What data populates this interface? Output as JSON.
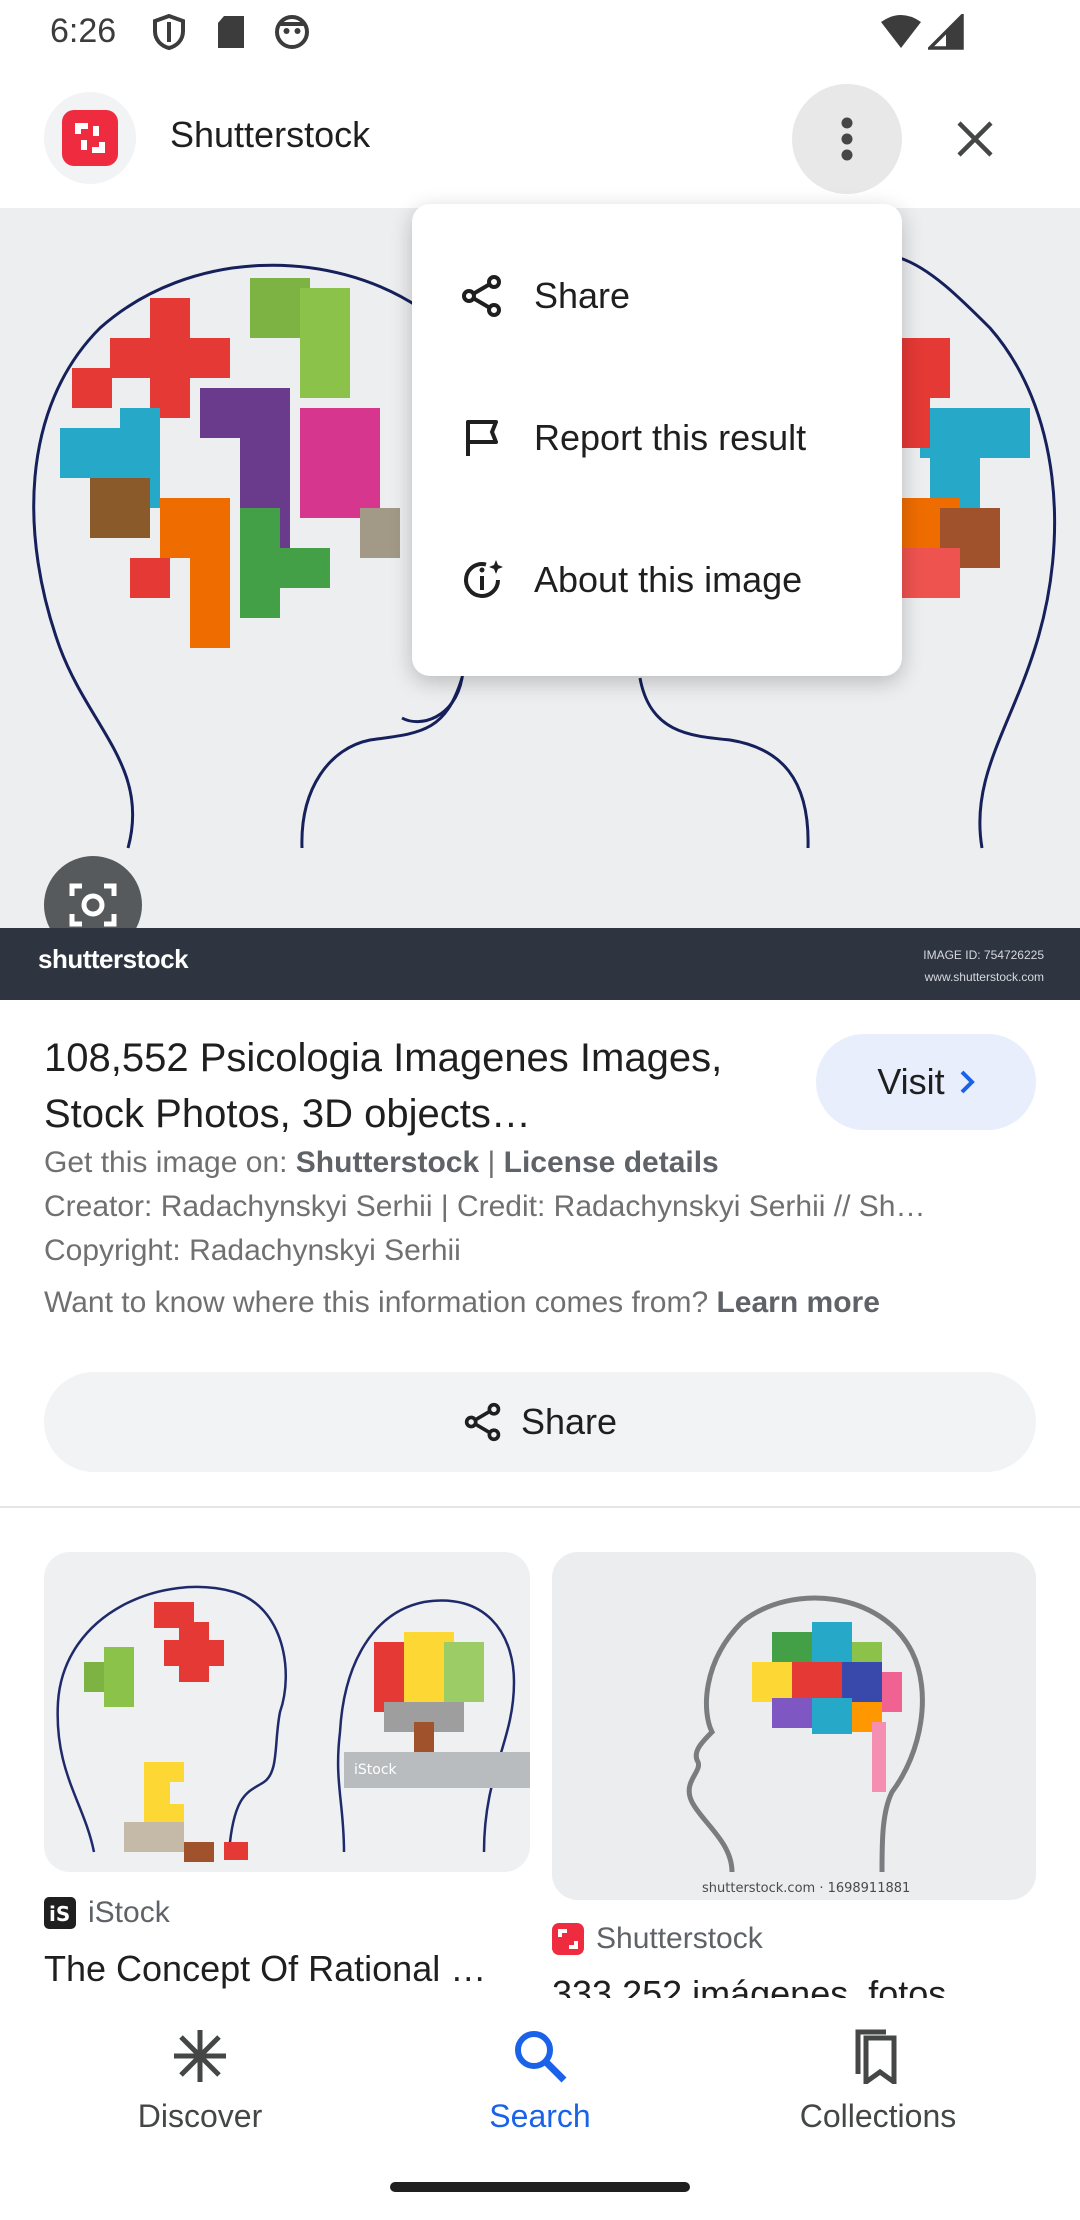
{
  "status_bar": {
    "time": "6:26"
  },
  "header": {
    "site_name": "Shutterstock"
  },
  "hero": {
    "brand": "shutterstock",
    "image_id": "IMAGE ID: 754726225",
    "url": "www.shutterstock.com"
  },
  "menu": {
    "items": [
      {
        "label": "Share",
        "icon": "share-icon"
      },
      {
        "label": "Report this result",
        "icon": "flag-icon"
      },
      {
        "label": "About this image",
        "icon": "about-image-icon"
      }
    ]
  },
  "result": {
    "title": "108,552 Psicologia Imagenes Images, Stock Photos, 3D objects…",
    "visit_label": "Visit",
    "get_image_prefix": "Get this image on: ",
    "get_image_source": "Shutterstock",
    "separator": " | ",
    "license": "License details",
    "creator_line": "Creator: Radachynskyi Serhii | Credit: Radachynskyi Serhii // Sh…",
    "copyright_line": "Copyright: Radachynskyi Serhii",
    "learn_prefix": "Want to know where this information comes from? ",
    "learn_more": "Learn more",
    "share_label": "Share"
  },
  "related": [
    {
      "source": "iStock",
      "title": "The Concept Of Rational …",
      "watermark": "iStock"
    },
    {
      "source": "Shutterstock",
      "title": "333.252 imágenes, fotos",
      "caption": "shutterstock.com · 1698911881"
    }
  ],
  "bottom_nav": {
    "items": [
      {
        "label": "Discover",
        "icon": "discover-icon",
        "active": false
      },
      {
        "label": "Search",
        "icon": "search-icon",
        "active": true
      },
      {
        "label": "Collections",
        "icon": "collections-icon",
        "active": false
      }
    ]
  },
  "colors": {
    "accent": "#1a63e8",
    "brand_red": "#ee2b3f",
    "visit_bg": "#e8eefc"
  }
}
